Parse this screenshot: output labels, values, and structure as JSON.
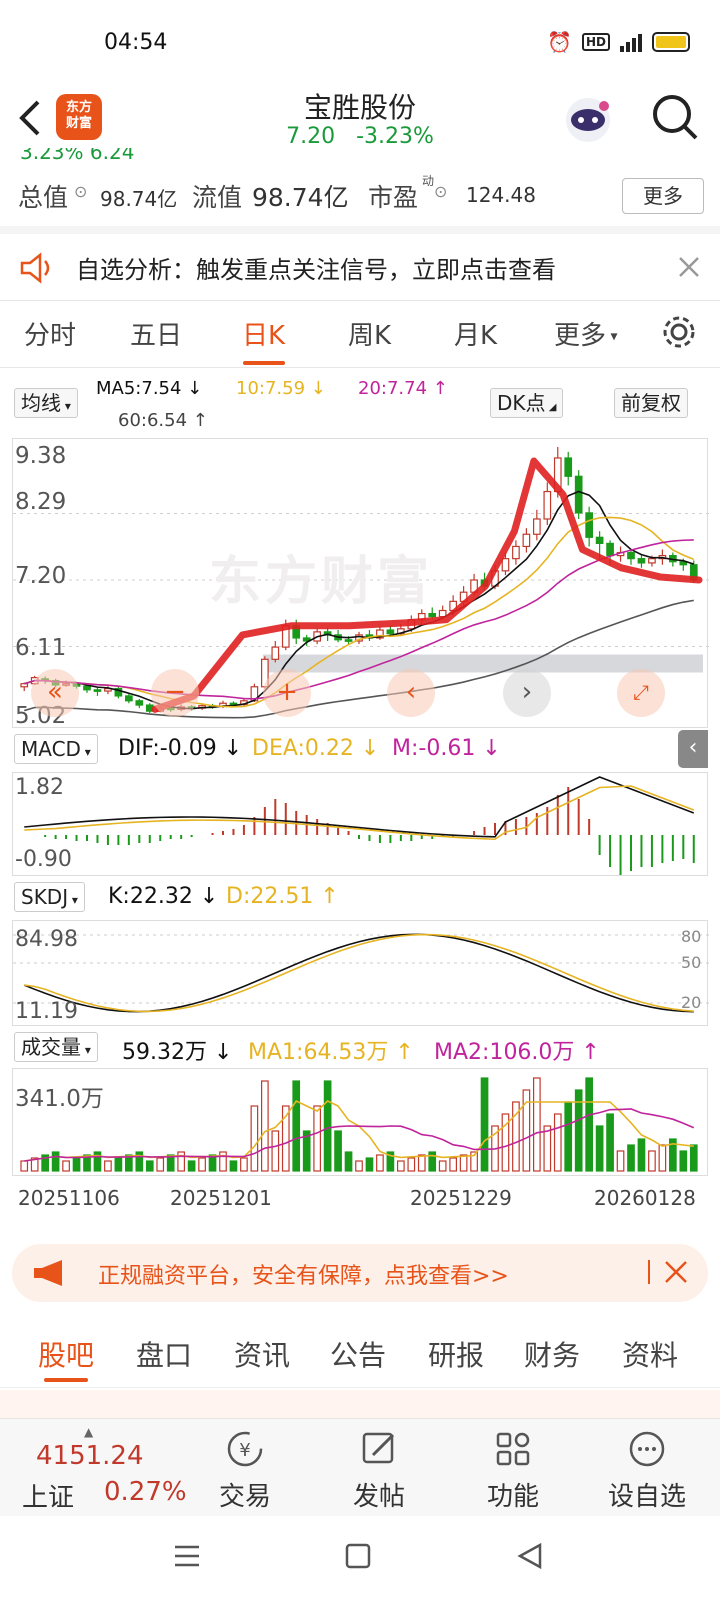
{
  "status": {
    "time": "04:54"
  },
  "header": {
    "logo_text_1": "东方",
    "logo_text_2": "财富",
    "title": "宝胜股份",
    "price": "7.20",
    "change": "-3.23%"
  },
  "stats": {
    "clipped_partial": "3.23%   6.24",
    "zongzhi_label": "总值",
    "zongzhi_value": "98.74亿",
    "liuzhi_label": "流值",
    "liuzhi_value": "98.74亿",
    "shiying_label": "市盈",
    "shiying_sup": "动",
    "shiying_value": "124.48",
    "more_label": "更多"
  },
  "notice": {
    "text": "自选分析：触发重点关注信号，立即点击查看"
  },
  "tabs": [
    "分时",
    "五日",
    "日K",
    "周K",
    "月K",
    "更多"
  ],
  "kline": {
    "ma_selector": "均线",
    "ma5": "MA5:7.54",
    "ma10": "10:7.59",
    "ma20": "20:7.74",
    "ma60": "60:6.54",
    "dk_label": "DK点",
    "fuquan_label": "前复权",
    "yticks": [
      "9.38",
      "8.29",
      "7.20",
      "6.11",
      "5.02"
    ],
    "watermark": "东方财富"
  },
  "macd": {
    "selector": "MACD",
    "dif": "DIF:-0.09",
    "dea": "DEA:0.22",
    "m": "M:-0.61",
    "top": "1.82",
    "bottom": "-0.90"
  },
  "kdj": {
    "selector": "SKDJ",
    "k": "K:22.32",
    "d": "D:22.51",
    "top": "84.98",
    "bottom": "11.19",
    "r80": "80",
    "r50": "50",
    "r20": "20"
  },
  "volume": {
    "selector": "成交量",
    "value": "59.32万",
    "ma1": "MA1:64.53万",
    "ma2": "MA2:106.0万",
    "top": "341.0万"
  },
  "dates": [
    "20251106",
    "20251201",
    "20251229",
    "20260128"
  ],
  "banner": {
    "text": "正规融资平台，安全有保障，点我查看>>"
  },
  "subtabs": [
    "股吧",
    "盘口",
    "资讯",
    "公告",
    "研报",
    "财务",
    "资料"
  ],
  "bottom": {
    "index_value": "4151.24",
    "index_name": "上证",
    "index_change": "0.27%",
    "trade": "交易",
    "post": "发帖",
    "func": "功能",
    "watch": "设自选"
  },
  "colors": {
    "accent": "#e8531a",
    "up": "#c0392b",
    "down": "#1a9a1a",
    "ma5": "#111111",
    "ma10": "#e6b422",
    "ma20": "#c0249c",
    "ma60": "#555555"
  },
  "chart_data": {
    "type": "candlestick",
    "ylim": [
      5.02,
      9.38
    ],
    "candles": [
      [
        5.45,
        5.5,
        5.38,
        5.52
      ],
      [
        5.5,
        5.6,
        5.48,
        5.63
      ],
      [
        5.58,
        5.55,
        5.5,
        5.62
      ],
      [
        5.55,
        5.48,
        5.44,
        5.58
      ],
      [
        5.48,
        5.5,
        5.45,
        5.55
      ],
      [
        5.5,
        5.46,
        5.42,
        5.53
      ],
      [
        5.46,
        5.4,
        5.35,
        5.5
      ],
      [
        5.4,
        5.38,
        5.3,
        5.44
      ],
      [
        5.38,
        5.42,
        5.33,
        5.46
      ],
      [
        5.42,
        5.3,
        5.26,
        5.45
      ],
      [
        5.3,
        5.22,
        5.18,
        5.34
      ],
      [
        5.22,
        5.15,
        5.1,
        5.25
      ],
      [
        5.15,
        5.05,
        5.02,
        5.18
      ],
      [
        5.05,
        5.1,
        5.03,
        5.14
      ],
      [
        5.1,
        5.08,
        5.04,
        5.13
      ],
      [
        5.08,
        5.12,
        5.05,
        5.16
      ],
      [
        5.12,
        5.1,
        5.06,
        5.15
      ],
      [
        5.1,
        5.14,
        5.07,
        5.18
      ],
      [
        5.14,
        5.13,
        5.09,
        5.17
      ],
      [
        5.13,
        5.18,
        5.1,
        5.22
      ],
      [
        5.18,
        5.16,
        5.12,
        5.21
      ],
      [
        5.16,
        5.22,
        5.14,
        5.26
      ],
      [
        5.22,
        5.45,
        5.2,
        5.5
      ],
      [
        5.45,
        5.9,
        5.42,
        5.95
      ],
      [
        5.9,
        6.1,
        5.85,
        6.2
      ],
      [
        6.1,
        6.45,
        6.05,
        6.55
      ],
      [
        6.45,
        6.25,
        6.15,
        6.55
      ],
      [
        6.25,
        6.2,
        6.12,
        6.3
      ],
      [
        6.2,
        6.35,
        6.15,
        6.4
      ],
      [
        6.35,
        6.3,
        6.2,
        6.42
      ],
      [
        6.3,
        6.22,
        6.18,
        6.38
      ],
      [
        6.22,
        6.2,
        6.15,
        6.28
      ],
      [
        6.2,
        6.3,
        6.15,
        6.35
      ],
      [
        6.3,
        6.25,
        6.2,
        6.38
      ],
      [
        6.25,
        6.38,
        6.22,
        6.45
      ],
      [
        6.38,
        6.32,
        6.28,
        6.46
      ],
      [
        6.32,
        6.4,
        6.28,
        6.48
      ],
      [
        6.4,
        6.55,
        6.35,
        6.62
      ],
      [
        6.55,
        6.65,
        6.48,
        6.72
      ],
      [
        6.65,
        6.6,
        6.55,
        6.75
      ],
      [
        6.6,
        6.7,
        6.55,
        6.78
      ],
      [
        6.7,
        6.85,
        6.62,
        6.95
      ],
      [
        6.85,
        7.0,
        6.78,
        7.1
      ],
      [
        7.0,
        7.2,
        6.95,
        7.3
      ],
      [
        7.2,
        7.1,
        7.02,
        7.32
      ],
      [
        7.1,
        7.35,
        7.05,
        7.45
      ],
      [
        7.35,
        7.55,
        7.28,
        7.65
      ],
      [
        7.55,
        7.75,
        7.45,
        7.85
      ],
      [
        7.75,
        7.95,
        7.65,
        8.05
      ],
      [
        7.95,
        8.2,
        7.85,
        8.35
      ],
      [
        8.2,
        8.65,
        8.1,
        8.8
      ],
      [
        8.65,
        9.2,
        8.55,
        9.38
      ],
      [
        9.2,
        8.9,
        8.75,
        9.3
      ],
      [
        8.9,
        8.3,
        8.2,
        9.0
      ],
      [
        8.3,
        7.9,
        7.75,
        8.4
      ],
      [
        7.9,
        7.8,
        7.55,
        8.0
      ],
      [
        7.8,
        7.6,
        7.45,
        7.85
      ],
      [
        7.6,
        7.65,
        7.5,
        7.75
      ],
      [
        7.65,
        7.55,
        7.45,
        7.7
      ],
      [
        7.55,
        7.48,
        7.4,
        7.62
      ],
      [
        7.48,
        7.55,
        7.42,
        7.6
      ],
      [
        7.55,
        7.6,
        7.45,
        7.7
      ],
      [
        7.6,
        7.5,
        7.42,
        7.65
      ],
      [
        7.5,
        7.45,
        7.35,
        7.55
      ],
      [
        7.45,
        7.2,
        7.15,
        7.52
      ]
    ],
    "yticks": [
      9.38,
      8.29,
      7.2,
      6.11,
      5.02
    ]
  }
}
